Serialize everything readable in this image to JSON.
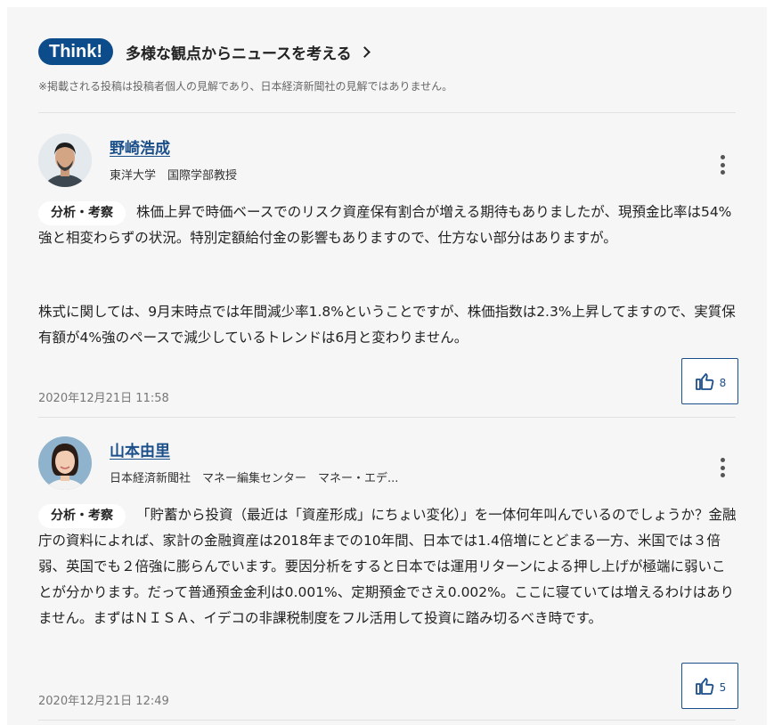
{
  "header": {
    "badge": "Think!",
    "title": "多様な観点からニュースを考える",
    "disclaimer": "※掲載される投稿は投稿者個人の見解であり、日本経済新聞社の見解ではありません。"
  },
  "comments": [
    {
      "name": "野崎浩成",
      "affiliation": "東洋大学　国際学部教授",
      "tag": "分析・考察",
      "paragraphs": [
        "株価上昇で時価ベースでのリスク資産保有割合が増える期待もありましたが、現預金比率は54%強と相変わらずの状況。特別定額給付金の影響もありますので、仕方ない部分はありますが。",
        "株式に関しては、9月末時点では年間減少率1.8%ということですが、株価指数は2.3%上昇してますので、実質保有額が4%強のペースで減少しているトレンドは6月と変わりません。"
      ],
      "timestamp": "2020年12月21日 11:58",
      "likes": "8"
    },
    {
      "name": "山本由里",
      "affiliation": "日本経済新聞社　マネー編集センター　マネー・エデ...",
      "tag": "分析・考察",
      "paragraphs": [
        "「貯蓄から投資（最近は「資産形成」にちょい変化）」を一体何年叫んでいるのでしょうか？金融庁の資料によれば、家計の金融資産は2018年までの10年間、日本では1.4倍増にとどまる一方、米国では３倍弱、英国でも２倍強に膨らんでいます。要因分析をすると日本では運用リターンによる押し上げが極端に弱いことが分かります。だって普通預金金利は0.001%、定期預金でさえ0.002%。ここに寝ていては増えるわけはありません。まずはＮＩＳＡ、イデコの非課税制度をフル活用して投資に踏み切るべき時です。"
      ],
      "timestamp": "2020年12月21日 12:49",
      "likes": "5"
    }
  ]
}
